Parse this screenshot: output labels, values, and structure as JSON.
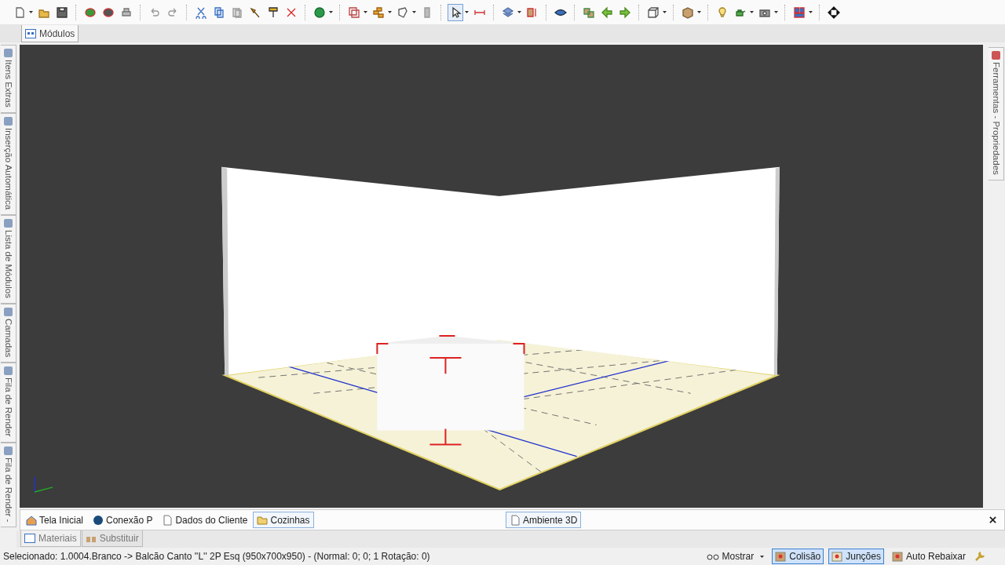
{
  "module_tabs": [
    {
      "label": "Módulos",
      "selected": true
    }
  ],
  "left_panel_tabs": [
    {
      "label": "Itens Extras"
    },
    {
      "label": "Inserção Automática"
    },
    {
      "label": "Lista de Módulos"
    },
    {
      "label": "Camadas"
    },
    {
      "label": "Fila de Render"
    },
    {
      "label": "Fila de Render -"
    }
  ],
  "right_panel_tabs": [
    {
      "label": "Ferramentas - Propriedades"
    }
  ],
  "document_tabs": [
    {
      "label": "Tela Inicial",
      "selected": false
    },
    {
      "label": "Conexão P",
      "selected": false
    },
    {
      "label": "Dados do Cliente",
      "selected": false
    },
    {
      "label": "Cozinhas",
      "selected": true
    }
  ],
  "view_tabs": [
    {
      "label": "Ambiente 3D",
      "selected": true
    }
  ],
  "bottom_panel_tabs": [
    {
      "label": "Materiais",
      "selected": true
    },
    {
      "label": "Substituir",
      "selected": false
    }
  ],
  "status_bar": {
    "text": "Selecionado: 1.0004.Branco -> Balcão Canto ''L'' 2P Esq (950x700x950) - (Normal: 0; 0; 1 Rotação: 0)",
    "tools": [
      {
        "kind": "dropdown",
        "label": "Mostrar"
      },
      {
        "kind": "toggle",
        "label": "Colisão",
        "on": true
      },
      {
        "kind": "toggle",
        "label": "Junções",
        "on": true
      },
      {
        "kind": "toggle",
        "label": "Auto Rebaixar",
        "on": false
      }
    ]
  }
}
